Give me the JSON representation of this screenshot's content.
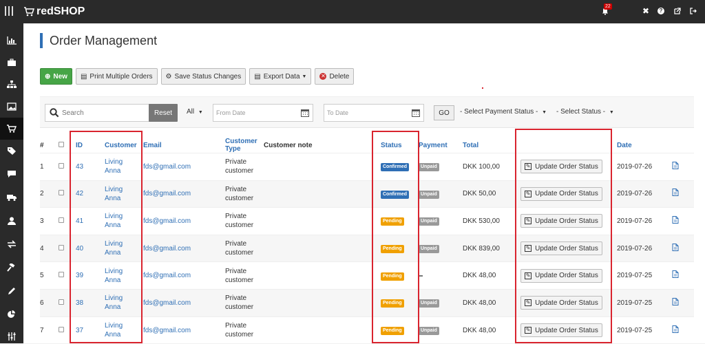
{
  "header": {
    "brand": "redSHOP",
    "notif_count": "22"
  },
  "page": {
    "title": "Order Management"
  },
  "toolbar": {
    "new_label": "New",
    "print_label": "Print Multiple Orders",
    "save_status_label": "Save Status Changes",
    "export_label": "Export Data",
    "delete_label": "Delete"
  },
  "filters": {
    "search_placeholder": "Search",
    "reset_label": "Reset",
    "all_label": "All",
    "from_date_placeholder": "From Date",
    "to_date_placeholder": "To Date",
    "go_label": "GO",
    "payment_status_placeholder": "- Select Payment Status -",
    "status_placeholder": "- Select Status -"
  },
  "columns": {
    "num": "#",
    "id": "ID",
    "customer": "Customer",
    "email": "Email",
    "type_l1": "Customer",
    "type_l2": "Type",
    "note": "Customer note",
    "status": "Status",
    "payment": "Payment",
    "total": "Total",
    "date": "Date"
  },
  "update_label": "Update Order Status",
  "orders": [
    {
      "num": "1",
      "id": "43",
      "cust1": "Living",
      "cust2": "Anna",
      "email": "fds@gmail.com",
      "type1": "Private",
      "type2": "customer",
      "status": "Confirmed",
      "payment": "Unpaid",
      "total": "DKK 100,00",
      "date": "2019-07-26"
    },
    {
      "num": "2",
      "id": "42",
      "cust1": "Living",
      "cust2": "Anna",
      "email": "fds@gmail.com",
      "type1": "Private",
      "type2": "customer",
      "status": "Confirmed",
      "payment": "Unpaid",
      "total": "DKK 50,00",
      "date": "2019-07-26"
    },
    {
      "num": "3",
      "id": "41",
      "cust1": "Living",
      "cust2": "Anna",
      "email": "fds@gmail.com",
      "type1": "Private",
      "type2": "customer",
      "status": "Pending",
      "payment": "Unpaid",
      "total": "DKK 530,00",
      "date": "2019-07-26"
    },
    {
      "num": "4",
      "id": "40",
      "cust1": "Living",
      "cust2": "Anna",
      "email": "fds@gmail.com",
      "type1": "Private",
      "type2": "customer",
      "status": "Pending",
      "payment": "Unpaid",
      "total": "DKK 839,00",
      "date": "2019-07-26"
    },
    {
      "num": "5",
      "id": "39",
      "cust1": "Living",
      "cust2": "Anna",
      "email": "fds@gmail.com",
      "type1": "Private",
      "type2": "customer",
      "status": "Pending",
      "payment": "",
      "total": "DKK 48,00",
      "date": "2019-07-25"
    },
    {
      "num": "6",
      "id": "38",
      "cust1": "Living",
      "cust2": "Anna",
      "email": "fds@gmail.com",
      "type1": "Private",
      "type2": "customer",
      "status": "Pending",
      "payment": "Unpaid",
      "total": "DKK 48,00",
      "date": "2019-07-25"
    },
    {
      "num": "7",
      "id": "37",
      "cust1": "Living",
      "cust2": "Anna",
      "email": "fds@gmail.com",
      "type1": "Private",
      "type2": "customer",
      "status": "Pending",
      "payment": "Unpaid",
      "total": "DKK 48,00",
      "date": "2019-07-25"
    }
  ],
  "colors": {
    "accent": "#2f6fb5",
    "confirmed": "#2f6fb5",
    "pending": "#f0a000",
    "unpaid": "#999999",
    "highlight": "#d9232e",
    "new_button": "#46a546"
  },
  "icons": {
    "menu": "hamburger-icon",
    "cart": "cart-icon",
    "bell": "bell-icon",
    "joomla": "joomla-icon",
    "help": "help-icon",
    "external": "external-link-icon",
    "logout": "logout-icon",
    "edit": "edit-icon",
    "pdf": "pdf-icon"
  }
}
